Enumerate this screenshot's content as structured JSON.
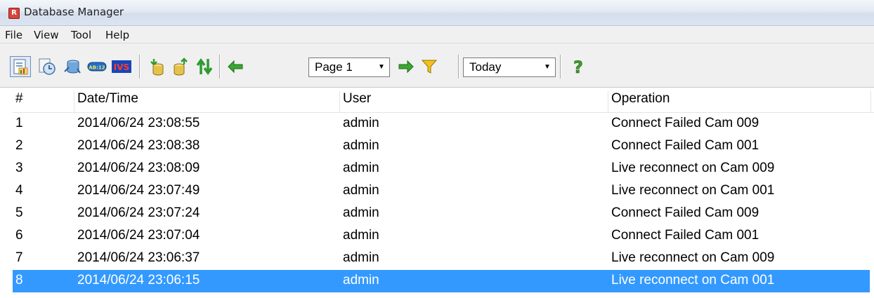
{
  "window": {
    "title": "Database Manager"
  },
  "menu": [
    "File",
    "View",
    "Tool",
    "Help"
  ],
  "toolbar": {
    "page_select": "Page 1",
    "range_select": "Today",
    "buttons": [
      "operation-log",
      "history",
      "network",
      "sensor",
      "ivs",
      "import",
      "export",
      "sync",
      "prev-page",
      "next-page",
      "filter",
      "help"
    ]
  },
  "table": {
    "columns": [
      "#",
      "Date/Time",
      "User",
      "Operation"
    ],
    "rows": [
      {
        "num": "1",
        "datetime": "2014/06/24 23:08:55",
        "user": "admin",
        "operation": "Connect Failed Cam 009"
      },
      {
        "num": "2",
        "datetime": "2014/06/24 23:08:38",
        "user": "admin",
        "operation": "Connect Failed Cam 001"
      },
      {
        "num": "3",
        "datetime": "2014/06/24 23:08:09",
        "user": "admin",
        "operation": "Live reconnect on Cam 009"
      },
      {
        "num": "4",
        "datetime": "2014/06/24 23:07:49",
        "user": "admin",
        "operation": "Live reconnect on Cam 001"
      },
      {
        "num": "5",
        "datetime": "2014/06/24 23:07:24",
        "user": "admin",
        "operation": "Connect Failed Cam 009"
      },
      {
        "num": "6",
        "datetime": "2014/06/24 23:07:04",
        "user": "admin",
        "operation": "Connect Failed Cam 001"
      },
      {
        "num": "7",
        "datetime": "2014/06/24 23:06:37",
        "user": "admin",
        "operation": "Live reconnect on Cam 009"
      },
      {
        "num": "8",
        "datetime": "2014/06/24 23:06:15",
        "user": "admin",
        "operation": "Live reconnect on Cam 001"
      }
    ],
    "selected_row": 8
  },
  "colors": {
    "selection": "#3399ff",
    "filter": "#e8b800",
    "arrow": "#33a52b"
  }
}
